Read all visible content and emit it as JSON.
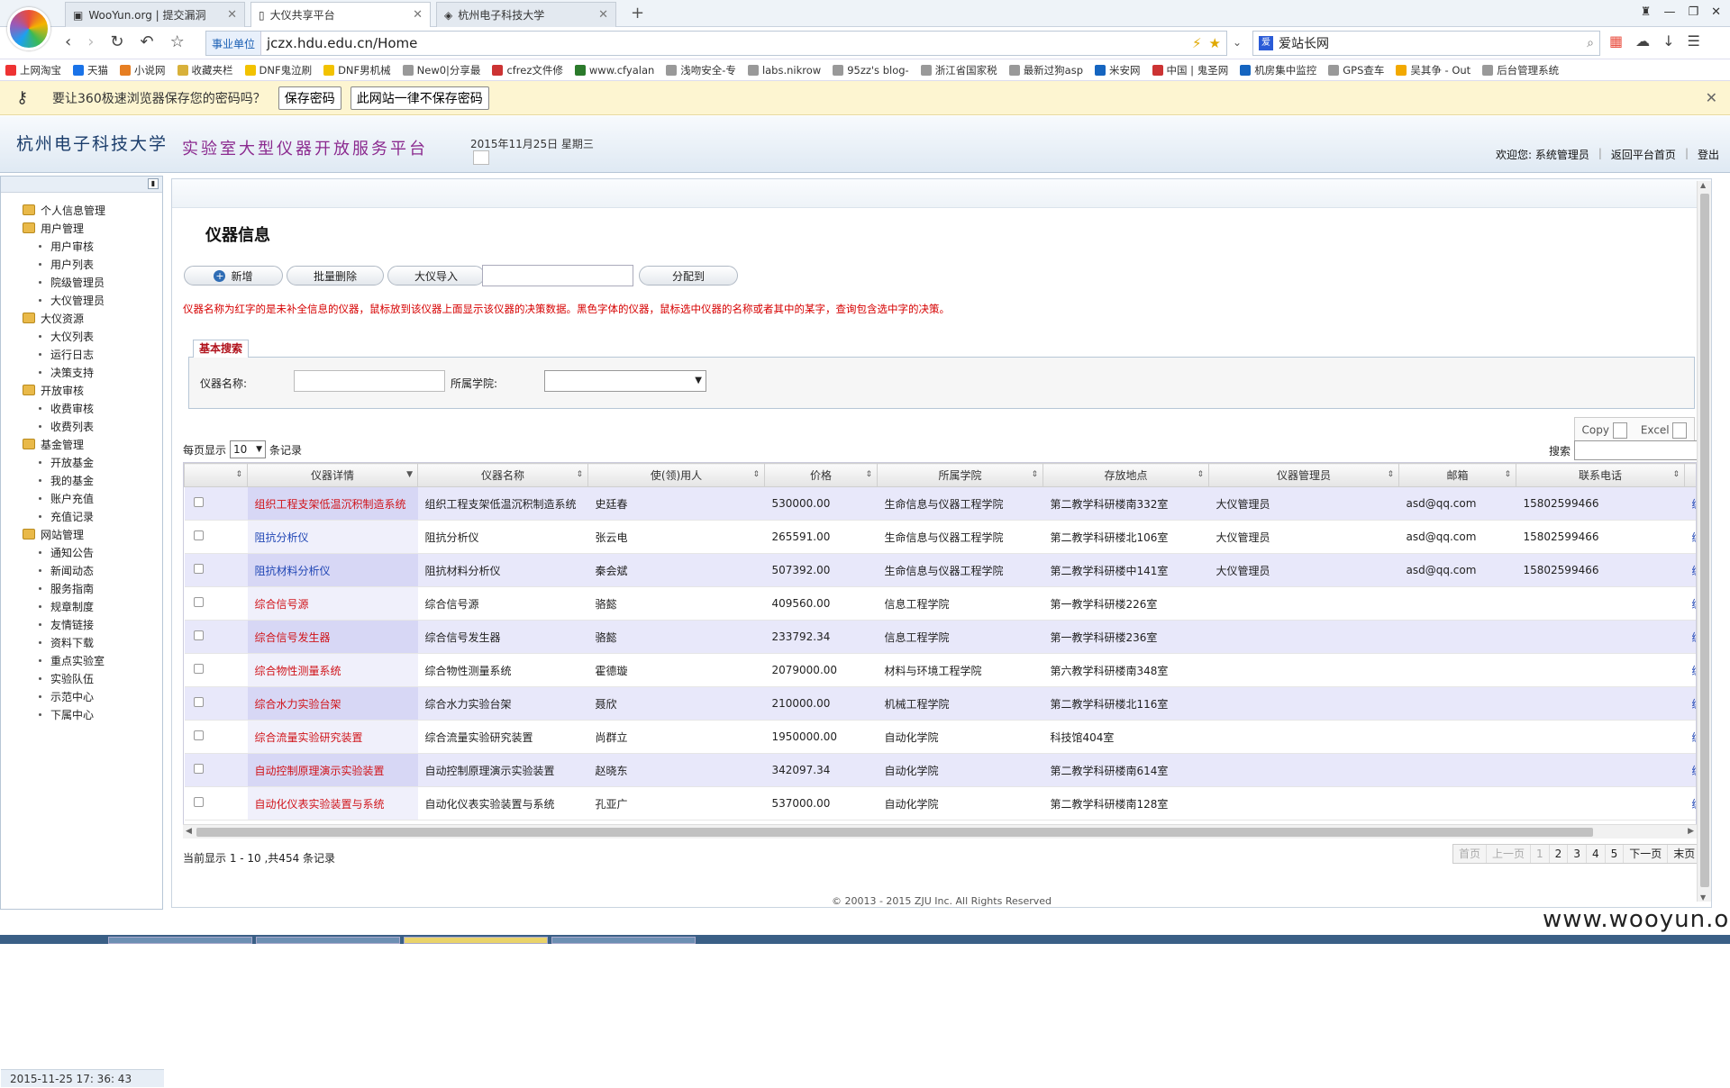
{
  "browser": {
    "tabs": [
      {
        "label": "WooYun.org | 提交漏洞",
        "active": false
      },
      {
        "label": "大仪共享平台",
        "active": true
      },
      {
        "label": "杭州电子科技大学",
        "active": false
      }
    ],
    "address": {
      "badge": "事业单位",
      "url": "jczx.hdu.edu.cn/Home"
    },
    "search_engine_text": "爱站长网",
    "bookmarks": [
      "上网淘宝",
      "天猫",
      "小说网",
      "收藏夹栏",
      "DNF鬼泣刷",
      "DNF男机械",
      "New0|分享最",
      "cfrez文件修",
      "www.cfyalan",
      "浅吻安全-专",
      "labs.nikrow",
      "95zz's blog-",
      "浙江省国家税",
      "最新过狗asp",
      "米安网",
      "中国 | 鬼圣网",
      "机房集中监控",
      "GPS查车",
      "吴其争 - Out",
      "后台管理系统"
    ],
    "infobar": {
      "message": "要让360极速浏览器保存您的密码吗？",
      "save": "保存密码",
      "never": "此网站一律不保存密码"
    }
  },
  "header": {
    "university": "杭州电子科技大学",
    "platform": "实验室大型仪器开放服务平台",
    "date": "2015年11月25日 星期三",
    "welcome": "欢迎您: 系统管理员",
    "back": "返回平台首页",
    "logout": "登出"
  },
  "sidebar": {
    "groups": [
      {
        "label": "个人信息管理",
        "children": []
      },
      {
        "label": "用户管理",
        "children": [
          "用户审核",
          "用户列表",
          "院级管理员",
          "大仪管理员"
        ]
      },
      {
        "label": "大仪资源",
        "children": [
          "大仪列表",
          "运行日志",
          "决策支持"
        ]
      },
      {
        "label": "开放审核",
        "children": [
          "收费审核",
          "收费列表"
        ]
      },
      {
        "label": "基金管理",
        "children": [
          "开放基金",
          "我的基金",
          "账户充值",
          "充值记录"
        ]
      },
      {
        "label": "网站管理",
        "children": [
          "通知公告",
          "新闻动态",
          "服务指南",
          "规章制度",
          "友情链接",
          "资料下载",
          "重点实验室",
          "实验队伍",
          "示范中心",
          "下属中心"
        ]
      }
    ],
    "clock": "2015-11-25   17: 36: 43"
  },
  "main": {
    "title": "仪器信息",
    "buttons": {
      "add": "新增",
      "batch_delete": "批量删除",
      "import": "大仪导入",
      "assign": "分配到"
    },
    "notice": "仪器名称为红字的是未补全信息的仪器，鼠标放到该仪器上面显示该仪器的决策数据。黑色字体的仪器，鼠标选中仪器的名称或者其中的某字，查询包含选中字的决策。",
    "search": {
      "tab": "基本搜索",
      "name_label": "仪器名称:",
      "college_label": "所属学院:"
    },
    "export": {
      "copy": "Copy",
      "excel": "Excel"
    },
    "page_size": {
      "prefix": "每页显示",
      "value": "10",
      "suffix": "条记录"
    },
    "table_search_label": "搜索",
    "columns": [
      "",
      "仪器详情",
      "仪器名称",
      "使(领)用人",
      "价格",
      "所属学院",
      "存放地点",
      "仪器管理员",
      "邮箱",
      "联系电话"
    ],
    "rows": [
      {
        "detail": "组织工程支架低温沉积制造系统",
        "color": "red",
        "name": "组织工程支架低温沉积制造系统",
        "user": "史廷春",
        "price": "530000.00",
        "college": "生命信息与仪器工程学院",
        "location": "第二教学科研楼南332室",
        "manager": "大仪管理员",
        "email": "asd@qq.com",
        "phone": "15802599466"
      },
      {
        "detail": "阻抗分析仪",
        "color": "blue",
        "name": "阻抗分析仪",
        "user": "张云电",
        "price": "265591.00",
        "college": "生命信息与仪器工程学院",
        "location": "第二教学科研楼北106室",
        "manager": "大仪管理员",
        "email": "asd@qq.com",
        "phone": "15802599466"
      },
      {
        "detail": "阻抗材料分析仪",
        "color": "blue",
        "name": "阻抗材料分析仪",
        "user": "秦会斌",
        "price": "507392.00",
        "college": "生命信息与仪器工程学院",
        "location": "第二教学科研楼中141室",
        "manager": "大仪管理员",
        "email": "asd@qq.com",
        "phone": "15802599466"
      },
      {
        "detail": "综合信号源",
        "color": "red",
        "name": "综合信号源",
        "user": "骆懿",
        "price": "409560.00",
        "college": "信息工程学院",
        "location": "第一教学科研楼226室",
        "manager": "",
        "email": "",
        "phone": ""
      },
      {
        "detail": "综合信号发生器",
        "color": "red",
        "name": "综合信号发生器",
        "user": "骆懿",
        "price": "233792.34",
        "college": "信息工程学院",
        "location": "第一教学科研楼236室",
        "manager": "",
        "email": "",
        "phone": ""
      },
      {
        "detail": "综合物性测量系统",
        "color": "red",
        "name": "综合物性测量系统",
        "user": "霍德璇",
        "price": "2079000.00",
        "college": "材料与环境工程学院",
        "location": "第六教学科研楼南348室",
        "manager": "",
        "email": "",
        "phone": ""
      },
      {
        "detail": "综合水力实验台架",
        "color": "red",
        "name": "综合水力实验台架",
        "user": "聂欣",
        "price": "210000.00",
        "college": "机械工程学院",
        "location": "第二教学科研楼北116室",
        "manager": "",
        "email": "",
        "phone": ""
      },
      {
        "detail": "综合流量实验研究装置",
        "color": "red",
        "name": "综合流量实验研究装置",
        "user": "尚群立",
        "price": "1950000.00",
        "college": "自动化学院",
        "location": "科技馆404室",
        "manager": "",
        "email": "",
        "phone": ""
      },
      {
        "detail": "自动控制原理演示实验装置",
        "color": "red",
        "name": "自动控制原理演示实验装置",
        "user": "赵晓东",
        "price": "342097.34",
        "college": "自动化学院",
        "location": "第二教学科研楼南614室",
        "manager": "",
        "email": "",
        "phone": ""
      },
      {
        "detail": "自动化仪表实验装置与系统",
        "color": "red",
        "name": "自动化仪表实验装置与系统",
        "user": "孔亚广",
        "price": "537000.00",
        "college": "自动化学院",
        "location": "第二教学科研楼南128室",
        "manager": "",
        "email": "",
        "phone": ""
      }
    ],
    "row_extra": "编",
    "row_info": "当前显示 1 - 10 ,共454 条记录",
    "pager": [
      "首页",
      "上一页",
      "1",
      "2",
      "3",
      "4",
      "5",
      "下一页",
      "末页"
    ],
    "copyright": "© 20013 - 2015 ZJU Inc. All Rights Reserved"
  },
  "watermark": "www.wooyun.org"
}
